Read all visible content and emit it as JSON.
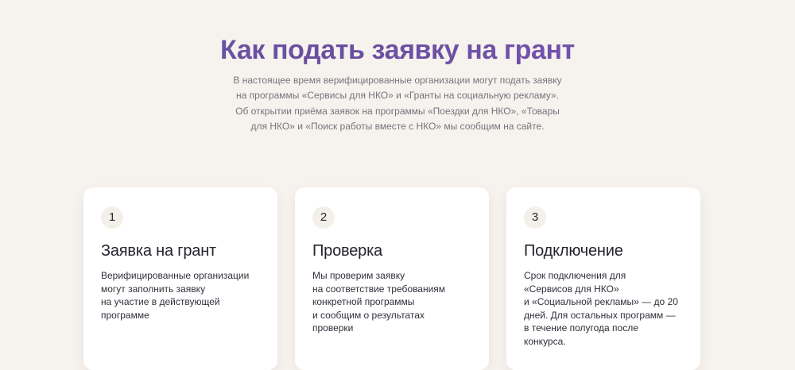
{
  "section": {
    "title": "Как подать заявку на грант",
    "subtitle": "В настоящее время верифицированные организации могут подать заявку на программы «Сервисы для НКО» и «Гранты на социальную рекламу». Об открытии приёма заявок на программы «Поездки для НКО», «Товары для НКО» и «Поиск работы вместе с НКО» мы сообщим на сайте."
  },
  "steps": [
    {
      "number": "1",
      "title": "Заявка на грант",
      "text": "Верифицированные организации\nмогут заполнить заявку\nна участие в  действующей\nпрограмме"
    },
    {
      "number": "2",
      "title": "Проверка",
      "text": "Мы проверим заявку\nна соответствие требованиям\nконкретной программы\nи сообщим о результатах\nпроверки"
    },
    {
      "number": "3",
      "title": "Подключение",
      "text": "Срок подключения для\n«Сервисов для НКО»\nи «Социальной рекламы» — до 20\nдней. Для остальных программ —\nв течение полугода после\nконкурса."
    }
  ],
  "colors": {
    "background": "#f6f2ee",
    "title_accent": "#6a4ea3",
    "card": "#ffffff",
    "badge": "#f3efe9"
  }
}
